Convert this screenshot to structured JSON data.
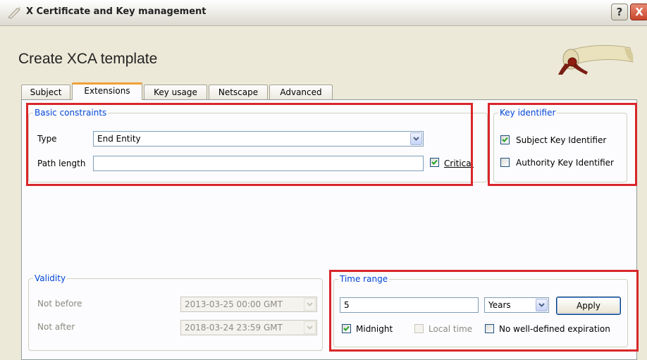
{
  "window": {
    "title": "X Certificate and Key management",
    "help_label": "?",
    "close_label": "X"
  },
  "page": {
    "heading": "Create XCA template"
  },
  "tabs": [
    {
      "label": "Subject"
    },
    {
      "label": "Extensions",
      "active": true
    },
    {
      "label": "Key usage"
    },
    {
      "label": "Netscape"
    },
    {
      "label": "Advanced"
    }
  ],
  "basic_constraints": {
    "title": "Basic constraints",
    "type_label": "Type",
    "type_value": "End Entity",
    "path_length_label": "Path length",
    "path_length_value": "",
    "critical_label": "Critical",
    "critical_checked": true
  },
  "key_identifier": {
    "title": "Key identifier",
    "subject_label": "Subject Key Identifier",
    "subject_checked": true,
    "authority_label": "Authority Key Identifier",
    "authority_checked": false
  },
  "validity": {
    "title": "Validity",
    "not_before_label": "Not before",
    "not_before_value": "2013-03-25 00:00 GMT",
    "not_after_label": "Not after",
    "not_after_value": "2018-03-24 23:59 GMT"
  },
  "time_range": {
    "title": "Time range",
    "amount_value": "5",
    "unit_value": "Years",
    "apply_label": "Apply",
    "midnight_label": "Midnight",
    "midnight_checked": true,
    "local_time_label": "Local time",
    "local_time_checked": false,
    "no_expiration_label": "No well-defined expiration",
    "no_expiration_checked": false
  },
  "colors": {
    "group_title": "#0046d5",
    "highlight_box": "#d8262a",
    "active_tab_accent": "#f0a036"
  }
}
